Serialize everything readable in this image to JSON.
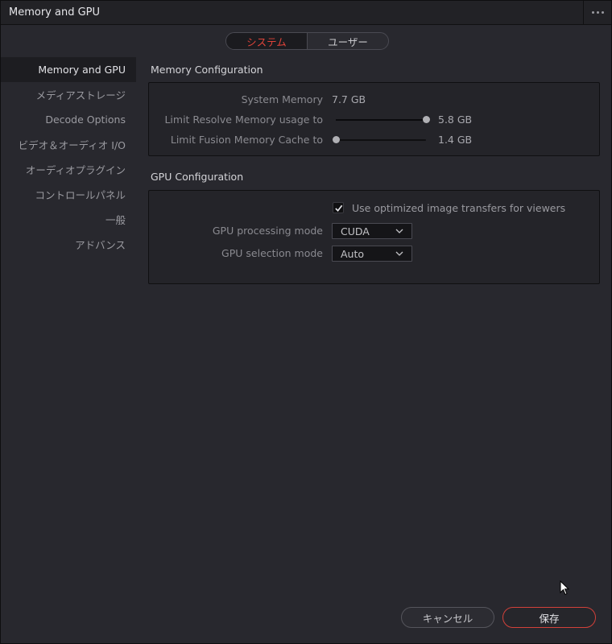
{
  "window": {
    "title": "Memory and GPU",
    "menu_icon": "more-horizontal-icon"
  },
  "tabs": [
    {
      "label": "システム",
      "active": true
    },
    {
      "label": "ユーザー",
      "active": false
    }
  ],
  "sidebar": {
    "items": [
      {
        "label": "Memory and GPU",
        "active": true
      },
      {
        "label": "メディアストレージ",
        "active": false
      },
      {
        "label": "Decode Options",
        "active": false
      },
      {
        "label": "ビデオ＆オーディオ I/O",
        "active": false
      },
      {
        "label": "オーディオプラグイン",
        "active": false
      },
      {
        "label": "コントロールパネル",
        "active": false
      },
      {
        "label": "一般",
        "active": false
      },
      {
        "label": "アドバンス",
        "active": false
      }
    ]
  },
  "memory": {
    "title": "Memory Configuration",
    "system_memory_label": "System Memory",
    "system_memory_value": "7.7 GB",
    "resolve_limit_label": "Limit Resolve Memory usage to",
    "resolve_limit_value": "5.8 GB",
    "resolve_limit_fraction": 1.0,
    "fusion_cache_label": "Limit Fusion Memory Cache to",
    "fusion_cache_value": "1.4 GB",
    "fusion_cache_fraction": 0.0
  },
  "gpu": {
    "title": "GPU Configuration",
    "optimized_transfers_label": "Use optimized image transfers for viewers",
    "optimized_transfers_checked": true,
    "processing_mode_label": "GPU processing mode",
    "processing_mode_value": "CUDA",
    "selection_mode_label": "GPU selection mode",
    "selection_mode_value": "Auto"
  },
  "footer": {
    "cancel_label": "キャンセル",
    "save_label": "保存"
  },
  "colors": {
    "accent": "#e0443a",
    "background": "#28282e",
    "panel": "#242429"
  }
}
